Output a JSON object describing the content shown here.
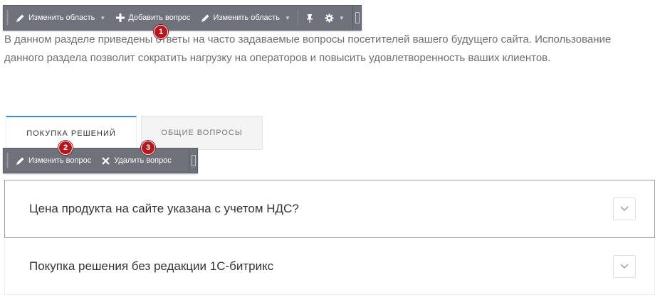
{
  "toolbar_top": {
    "edit_area_1": "Изменить область",
    "add_question": "Добавить вопрос",
    "edit_area_2": "Изменить область",
    "icons": [
      "pencil-icon",
      "plus-icon",
      "pencil-icon",
      "pin-icon",
      "gear-icon"
    ]
  },
  "toolbar_item": {
    "edit_question": "Изменить вопрос",
    "delete_question": "Удалить вопрос",
    "icons": [
      "pencil-icon",
      "close-icon"
    ]
  },
  "badges": [
    "1",
    "2",
    "3"
  ],
  "intro": {
    "text": "В данном разделе приведены ответы на часто задаваемые вопросы посетителей вашего будущего сайта. Использование данного раздела позволит сократить нагрузку на операторов и повысить удовлетворенность ваших клиентов."
  },
  "tabs": [
    {
      "label": "ПОКУПКА РЕШЕНИЙ",
      "active": true
    },
    {
      "label": "ОБЩИЕ ВОПРОСЫ",
      "active": false
    }
  ],
  "faq": [
    {
      "question": "Цена продукта на сайте указана с учетом НДС?"
    },
    {
      "question": "Покупка решения без редакции 1С-битрикс"
    }
  ],
  "colors": {
    "toolbar_bg": "#6f727b",
    "badge_red": "#b8161c",
    "tab_accent": "#3b8fd9"
  }
}
